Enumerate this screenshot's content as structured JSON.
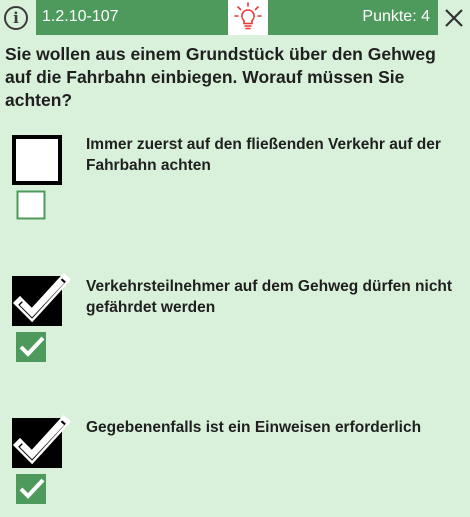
{
  "header": {
    "question_id": "1.2.10-107",
    "points_label": "Punkte: 4",
    "info_icon_glyph": "i",
    "hint_icon": "lightbulb-icon",
    "close_icon": "close-icon",
    "accent_color": "#4e9a5c",
    "hint_color": "#e53935"
  },
  "question": {
    "text": "Sie wollen aus einem Grundstück über den Gehweg auf die Fahrbahn einbiegen. Worauf müssen Sie achten?"
  },
  "answers": [
    {
      "text": "Immer zuerst auf den fließenden Verkehr auf der Fahrbahn achten",
      "user_checked": false,
      "correct": false
    },
    {
      "text": "Verkehrsteilnehmer auf dem Gehweg dürfen nicht gefährdet werden",
      "user_checked": true,
      "correct": true
    },
    {
      "text": "Gegebenenfalls ist ein Einweisen erforderlich",
      "user_checked": true,
      "correct": true
    }
  ],
  "colors": {
    "background": "#d9f1da",
    "solution_green": "#4e9a5c",
    "checkbox_black": "#000000"
  }
}
